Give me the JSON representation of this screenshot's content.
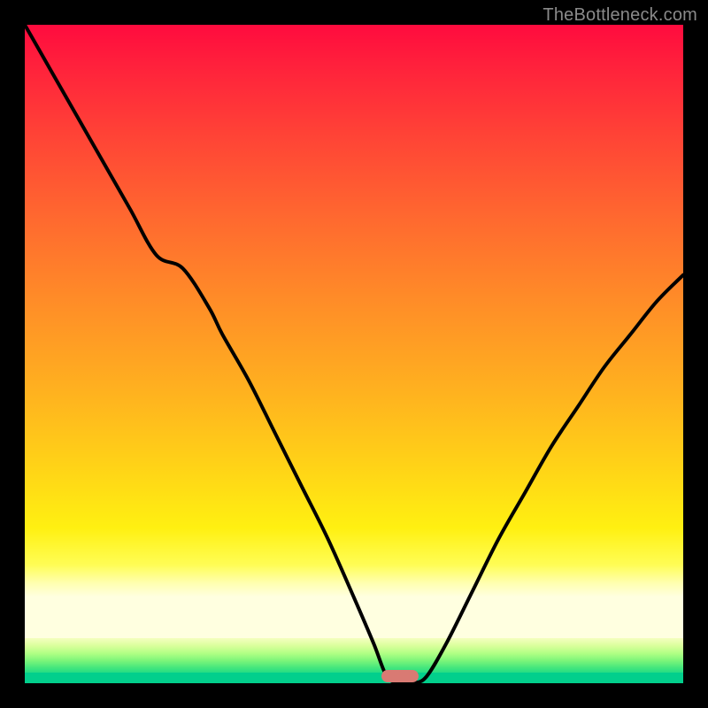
{
  "watermark": "TheBottleneck.com",
  "colors": {
    "frame": "#000000",
    "curve": "#000000",
    "pill": "#d97a73",
    "watermark_text": "#8a8a8a",
    "gradient_top": "#ff0b3e",
    "gradient_bottom_band": "#02cf8c"
  },
  "chart_data": {
    "type": "line",
    "title": "",
    "xlabel": "",
    "ylabel": "",
    "xlim": [
      0,
      100
    ],
    "ylim": [
      0,
      100
    ],
    "grid": false,
    "legend": false,
    "annotations": [
      {
        "text": "TheBottleneck.com",
        "position": "top-right"
      }
    ],
    "marker": {
      "shape": "pill",
      "x": 57,
      "y": 0,
      "color": "#d97a73"
    },
    "series": [
      {
        "name": "curve",
        "color": "#000000",
        "x": [
          0,
          4,
          8,
          12,
          16,
          20,
          24,
          28,
          30,
          34,
          38,
          42,
          46,
          50,
          53,
          55,
          57,
          59,
          61,
          64,
          68,
          72,
          76,
          80,
          84,
          88,
          92,
          96,
          100
        ],
        "y": [
          100,
          93,
          86,
          79,
          72,
          65,
          63,
          57,
          53,
          46,
          38,
          30,
          22,
          13,
          6,
          1,
          0,
          0,
          1,
          6,
          14,
          22,
          29,
          36,
          42,
          48,
          53,
          58,
          62
        ]
      }
    ],
    "background_gradient": {
      "direction": "vertical",
      "stops": [
        {
          "pos": 0.0,
          "color": "#ff0b3e"
        },
        {
          "pos": 0.18,
          "color": "#ff4336"
        },
        {
          "pos": 0.46,
          "color": "#ff8f27"
        },
        {
          "pos": 0.72,
          "color": "#ffd317"
        },
        {
          "pos": 0.88,
          "color": "#fffd55"
        },
        {
          "pos": 0.932,
          "color": "#ffffe0"
        },
        {
          "pos": 0.96,
          "color": "#7cf57a"
        },
        {
          "pos": 1.0,
          "color": "#02cf8c"
        }
      ]
    }
  }
}
